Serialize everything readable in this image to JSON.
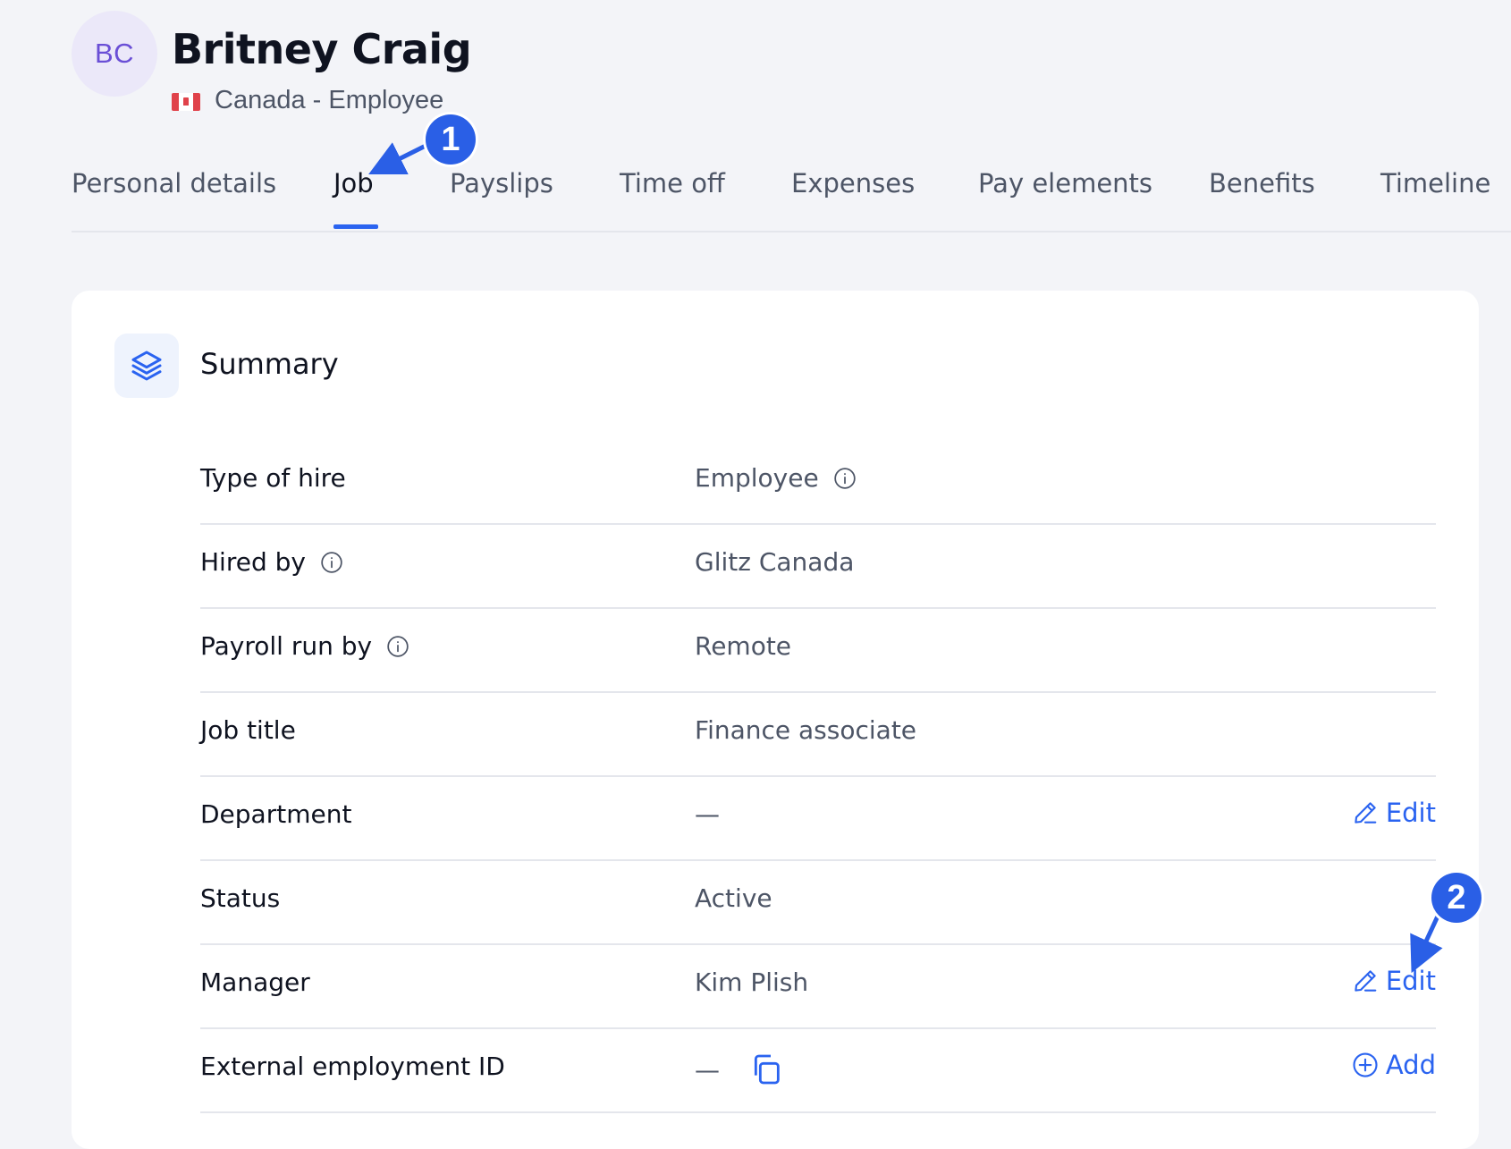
{
  "header": {
    "avatar_initials": "BC",
    "name": "Britney Craig",
    "subtitle": "Canada - Employee"
  },
  "tabs": [
    {
      "label": "Personal details"
    },
    {
      "label": "Job",
      "active": true
    },
    {
      "label": "Payslips"
    },
    {
      "label": "Time off"
    },
    {
      "label": "Expenses"
    },
    {
      "label": "Pay elements"
    },
    {
      "label": "Benefits"
    },
    {
      "label": "Timeline"
    }
  ],
  "annotations": {
    "step1": "1",
    "step2": "2"
  },
  "summary": {
    "title": "Summary",
    "rows": [
      {
        "label": "Type of hire",
        "value": "Employee"
      },
      {
        "label": "Hired by",
        "value": "Glitz Canada"
      },
      {
        "label": "Payroll run by",
        "value": "Remote"
      },
      {
        "label": "Job title",
        "value": "Finance associate"
      },
      {
        "label": "Department",
        "value": "—",
        "action": "Edit"
      },
      {
        "label": "Status",
        "value": "Active"
      },
      {
        "label": "Manager",
        "value": "Kim Plish",
        "action": "Edit"
      },
      {
        "label": "External employment ID",
        "value": "—",
        "action": "Add"
      }
    ]
  },
  "colors": {
    "accent": "#2a63f0",
    "badge": "#2a5fe6",
    "background": "#f3f4f8",
    "avatar_bg": "#ebe8f9",
    "avatar_text": "#6a4fd6"
  }
}
